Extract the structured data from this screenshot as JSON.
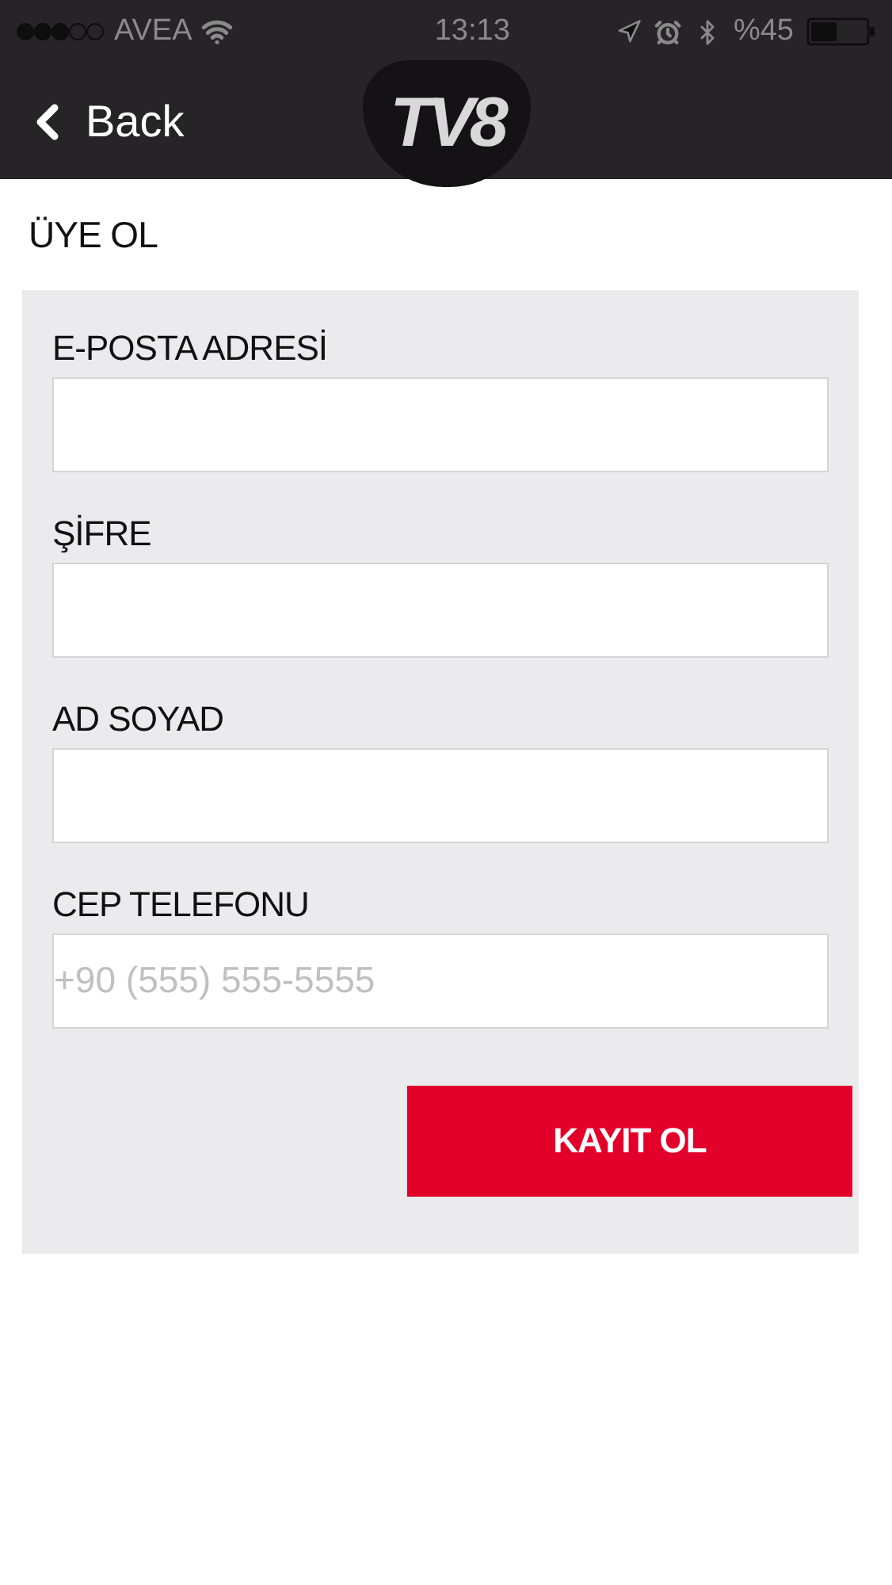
{
  "status_bar": {
    "carrier": "AVEA",
    "time": "13:13",
    "battery": "%45"
  },
  "nav": {
    "back": "Back",
    "logo": "TV8"
  },
  "title": "ÜYE OL",
  "fields": [
    {
      "label": "E-POSTA ADRESİ"
    },
    {
      "label": "ŞİFRE"
    },
    {
      "label": "AD SOYAD"
    },
    {
      "label": "CEP TELEFONU",
      "placeholder": "+90 (555) 555-5555"
    }
  ],
  "submit": "KAYIT OL"
}
